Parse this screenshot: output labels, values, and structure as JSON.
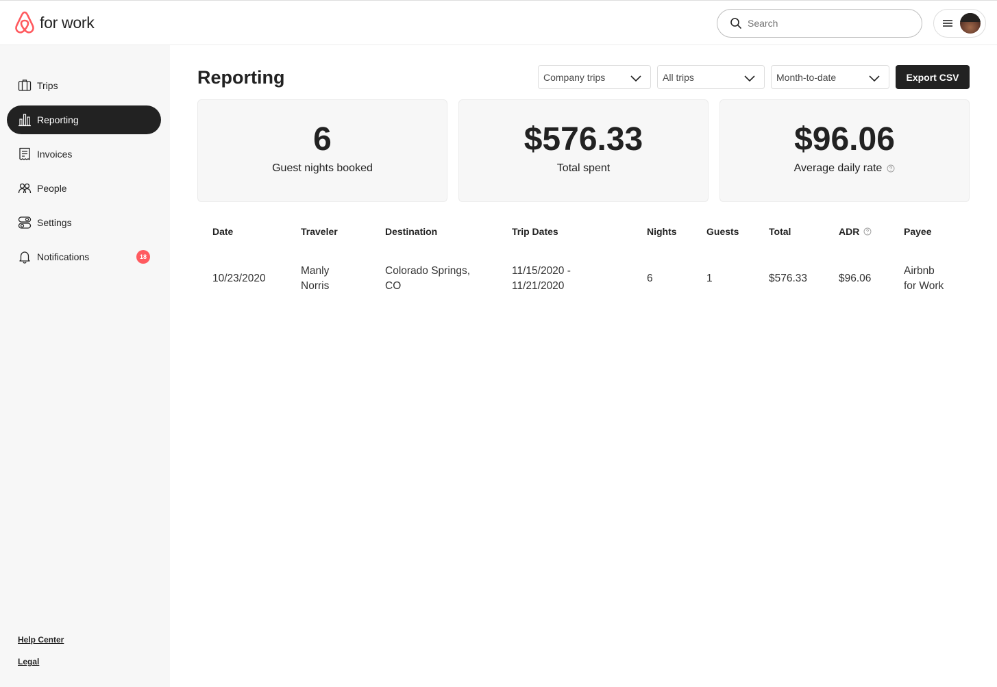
{
  "brand": {
    "logo_text": "for work",
    "accent": "#FF5A5F"
  },
  "header": {
    "search_placeholder": "Search"
  },
  "sidebar": {
    "items": [
      {
        "label": "Trips",
        "icon": "suitcase-icon",
        "active": false
      },
      {
        "label": "Reporting",
        "icon": "bar-chart-icon",
        "active": true
      },
      {
        "label": "Invoices",
        "icon": "receipt-icon",
        "active": false
      },
      {
        "label": "People",
        "icon": "people-icon",
        "active": false
      },
      {
        "label": "Settings",
        "icon": "toggles-icon",
        "active": false
      },
      {
        "label": "Notifications",
        "icon": "bell-icon",
        "active": false,
        "badge": "18"
      }
    ],
    "footer": {
      "help": "Help Center",
      "legal": "Legal"
    }
  },
  "main": {
    "title": "Reporting",
    "filters": {
      "trip_type": "Company trips",
      "trip_scope": "All trips",
      "period": "Month-to-date"
    },
    "export_label": "Export CSV",
    "stats": [
      {
        "value": "6",
        "label": "Guest nights booked"
      },
      {
        "value": "$576.33",
        "label": "Total spent"
      },
      {
        "value": "$96.06",
        "label": "Average daily rate"
      }
    ],
    "table": {
      "headers": [
        "Date",
        "Traveler",
        "Destination",
        "Trip Dates",
        "Nights",
        "Guests",
        "Total",
        "ADR",
        "Payee"
      ],
      "rows": [
        {
          "date": "10/23/2020",
          "traveler": [
            "Manly",
            "Norris"
          ],
          "destination": [
            "Colorado Springs,",
            "CO"
          ],
          "trip_dates": [
            "11/15/2020 -",
            "11/21/2020"
          ],
          "nights": "6",
          "guests": "1",
          "total": "$576.33",
          "adr": "$96.06",
          "payee": [
            "Airbnb",
            "for Work"
          ]
        }
      ]
    }
  }
}
